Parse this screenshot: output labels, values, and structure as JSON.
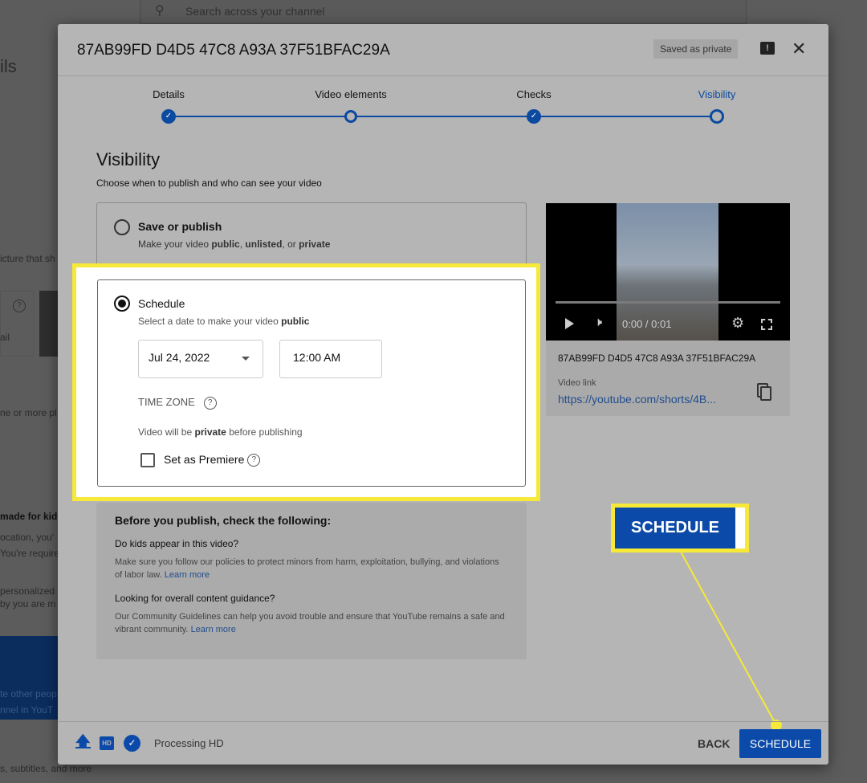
{
  "background": {
    "search_placeholder": "Search across your channel",
    "fragments": [
      "ils",
      "icture that sh",
      "ail",
      "ne or more pl",
      "made for kid",
      "ocation, you'",
      "You're require",
      "personalized",
      "by you are m",
      "te other peop",
      "nnel in YouT",
      "s, subtitles, and more"
    ]
  },
  "dialog": {
    "title": "87AB99FD D4D5 47C8 A93A 37F51BFAC29A",
    "saved_badge": "Saved as private"
  },
  "steps": [
    {
      "label": "Details",
      "state": "done"
    },
    {
      "label": "Video elements",
      "state": "open"
    },
    {
      "label": "Checks",
      "state": "done"
    },
    {
      "label": "Visibility",
      "state": "current"
    }
  ],
  "visibility": {
    "heading": "Visibility",
    "subtitle": "Choose when to publish and who can see your video",
    "save_or_publish": {
      "label": "Save or publish",
      "desc_parts": [
        "Make your video ",
        "public",
        ", ",
        "unlisted",
        ", or ",
        "private"
      ],
      "selected": false
    },
    "schedule": {
      "label": "Schedule",
      "desc": "Select a date to make your video ",
      "desc_bold": "public",
      "selected": true,
      "date": "Jul 24, 2022",
      "time": "12:00 AM",
      "time_zone_label": "TIME ZONE",
      "private_note": "Video will be ",
      "private_bold": "private",
      "private_note_end": " before publishing",
      "premiere_label": "Set as Premiere",
      "premiere_checked": false
    }
  },
  "checks": {
    "heading": "Before you publish, check the following:",
    "q1": "Do kids appear in this video?",
    "p1": "Make sure you follow our policies to protect minors from harm, exploitation, bullying, and violations of labor law. ",
    "learn_more": "Learn more",
    "q2": "Looking for overall content guidance?",
    "p2": "Our Community Guidelines can help you avoid trouble and ensure that YouTube remains a safe and vibrant community. "
  },
  "video": {
    "time": "0:00 / 0:01",
    "title": "87AB99FD D4D5 47C8 A93A 37F51BFAC29A",
    "link_label": "Video link",
    "link": "https://youtube.com/shorts/4B..."
  },
  "callout": {
    "label": "SCHEDULE",
    "color": "#f6e93a"
  },
  "footer": {
    "status": "Processing HD",
    "hd": "HD",
    "back": "BACK",
    "schedule": "SCHEDULE"
  },
  "colors": {
    "accent": "#0b4aa8",
    "highlight": "#f6e93a"
  }
}
